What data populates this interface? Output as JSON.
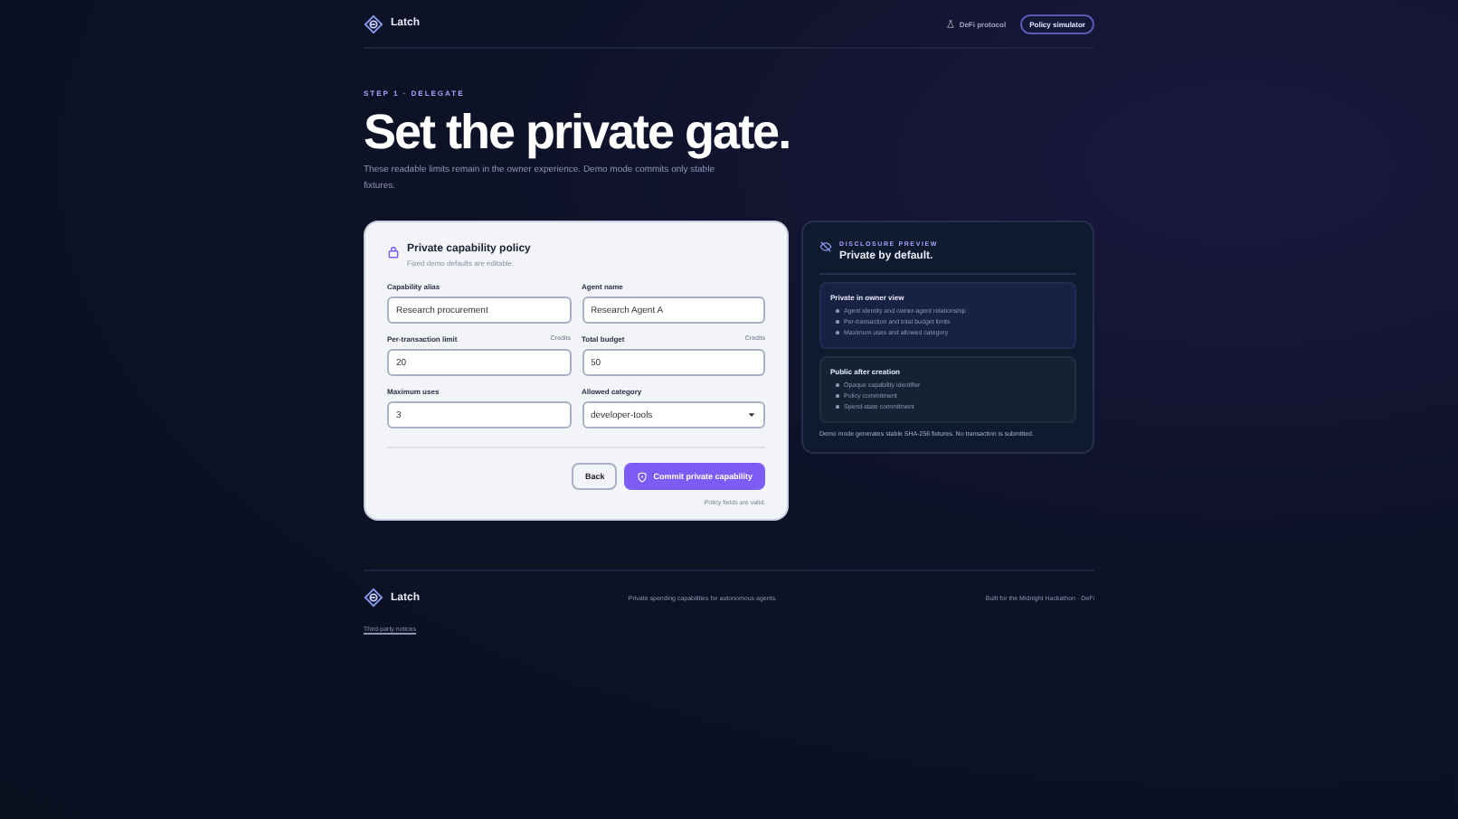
{
  "header": {
    "brand": "Latch",
    "nav": [
      {
        "label": "DeFi protocol",
        "selected": false,
        "kind": "protocol"
      },
      {
        "label": "Policy simulator",
        "selected": true,
        "kind": "plain"
      }
    ]
  },
  "hero": {
    "eyebrow": "STEP 1 · DELEGATE",
    "title": "Set the private gate.",
    "lede": "These readable limits remain in the owner experience. Demo mode commits only stable fixtures."
  },
  "form": {
    "title": "Private capability policy",
    "subtitle": "Fixed demo defaults are editable.",
    "fields": [
      {
        "label": "Capability alias",
        "value": "Research procurement",
        "kind": "text"
      },
      {
        "label": "Agent name",
        "value": "Research Agent A",
        "kind": "text"
      },
      {
        "label": "Per-transaction limit",
        "unit": "Credits",
        "value": "20",
        "kind": "text"
      },
      {
        "label": "Total budget",
        "unit": "Credits",
        "value": "50",
        "kind": "text"
      },
      {
        "label": "Maximum uses",
        "value": "3",
        "kind": "text"
      },
      {
        "label": "Allowed category",
        "value": "developer-tools",
        "kind": "select"
      }
    ],
    "buttons": [
      {
        "label": "Back",
        "kind": "secondary"
      },
      {
        "label": "Commit private capability",
        "kind": "primary"
      }
    ],
    "status": "Policy fields are valid."
  },
  "preview": {
    "eyebrow": "DISCLOSURE PREVIEW",
    "title": "Private by default.",
    "groups": [
      {
        "title": "Private in owner view",
        "kind": "private",
        "items": [
          "Agent identity and owner-agent relationship",
          "Per-transaction and total budget limits",
          "Maximum uses and allowed category"
        ]
      },
      {
        "title": "Public after creation",
        "kind": "public",
        "items": [
          "Opaque capability identifier",
          "Policy commitment",
          "Spend-state commitment"
        ]
      }
    ],
    "note": "Demo mode generates stable SHA-256 fixtures. No transaction is submitted."
  },
  "footer": {
    "brand": "Latch",
    "tagline": "Private spending capabilities for autonomous agents.",
    "credit": "Built for the Midnight Hackathon · DeFi",
    "link": "Third-party notices"
  }
}
